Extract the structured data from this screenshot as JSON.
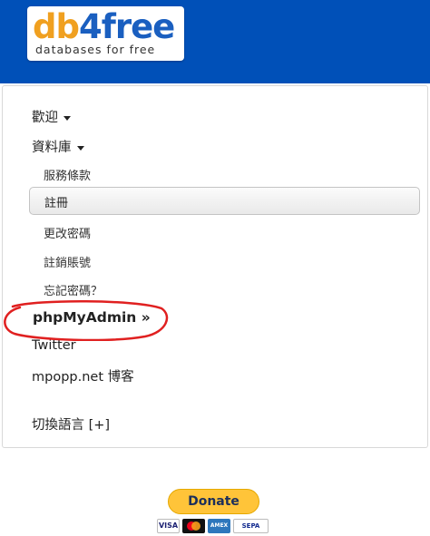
{
  "header": {
    "logo_part1": "db",
    "logo_part2": "4free",
    "logo_tagline": "databases for free"
  },
  "menu": {
    "welcome": "歡迎",
    "database": "資料庫",
    "terms": "服務條款",
    "register": "註冊",
    "change_password": "更改密碼",
    "delete_account": "註銷賬號",
    "forgot_password": "忘記密碼？",
    "phpmyadmin": "phpMyAdmin »",
    "twitter": "Twitter",
    "blog": "mpopp.net 博客",
    "switch_language": "切換語言 [+]"
  },
  "donate": {
    "label": "Donate",
    "cards": [
      "VISA",
      "Mastercard",
      "American Express",
      "SEPA"
    ]
  },
  "colors": {
    "header_bg": "#0050b8",
    "annotation": "#e02020",
    "donate_bg": "#ffc439"
  }
}
